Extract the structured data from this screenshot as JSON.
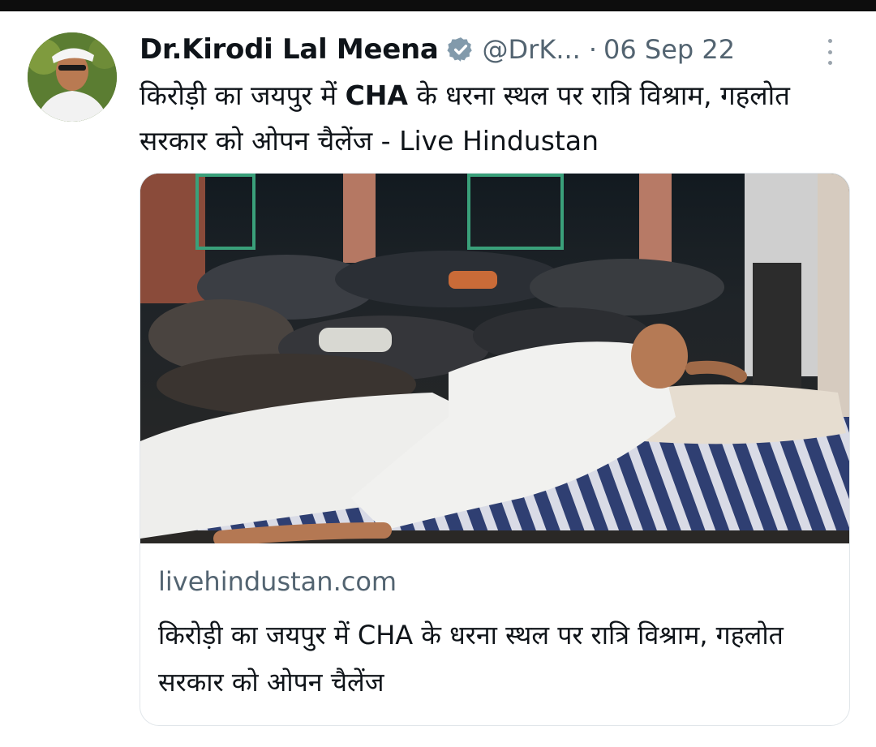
{
  "tweet": {
    "author_name": "Dr.Kirodi Lal Meena",
    "handle": "@DrK...",
    "separator": "·",
    "date": "06 Sep 22",
    "text_part1": "किरोड़ी का जयपुर में ",
    "text_bold": "CHA",
    "text_part2": " के धरना स्थल पर रात्रि विश्राम, गहलोत सरकार को ओपन चैलेंज - Live Hindustan"
  },
  "card": {
    "domain": "livehindustan.com",
    "title": "किरोड़ी का जयपुर में CHA के धरना स्थल पर रात्रि विश्राम, गहलोत सरकार को ओपन चैलेंज"
  },
  "icons": {
    "verified": "verified-badge-icon",
    "more": "more-options-icon"
  },
  "colors": {
    "verified_badge": "#829aab",
    "secondary_text": "#536471",
    "primary_text": "#0f1419"
  }
}
